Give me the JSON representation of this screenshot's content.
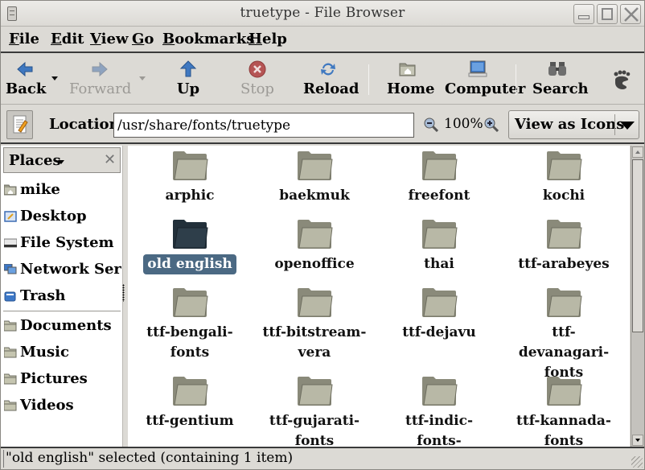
{
  "window": {
    "title": "truetype - File Browser",
    "controls": [
      "minimize",
      "maximize",
      "close"
    ]
  },
  "menubar": {
    "items": [
      {
        "label": "File",
        "mnemonic": "F"
      },
      {
        "label": "Edit",
        "mnemonic": "E"
      },
      {
        "label": "View",
        "mnemonic": "V"
      },
      {
        "label": "Go",
        "mnemonic": "G"
      },
      {
        "label": "Bookmarks",
        "mnemonic": "B"
      },
      {
        "label": "Help",
        "mnemonic": "H"
      }
    ]
  },
  "toolbar": {
    "back": {
      "label": "Back",
      "icon": "arrow-left-icon",
      "enabled": true
    },
    "forward": {
      "label": "Forward",
      "icon": "arrow-right-icon",
      "enabled": false
    },
    "up": {
      "label": "Up",
      "icon": "arrow-up-icon",
      "enabled": true
    },
    "stop": {
      "label": "Stop",
      "icon": "stop-icon",
      "enabled": false
    },
    "reload": {
      "label": "Reload",
      "icon": "reload-icon",
      "enabled": true
    },
    "home": {
      "label": "Home",
      "icon": "home-folder-icon",
      "enabled": true
    },
    "computer": {
      "label": "Computer",
      "icon": "computer-icon",
      "enabled": true
    },
    "search": {
      "label": "Search",
      "icon": "binoculars-icon",
      "enabled": true
    },
    "throbber": {
      "icon": "gnome-foot-icon"
    }
  },
  "locationbar": {
    "label": "Location:",
    "value": "/usr/share/fonts/truetype",
    "zoom_level": "100%",
    "view_mode": "View as Icons"
  },
  "sidebar": {
    "header": "Places",
    "places": [
      {
        "label": "mike",
        "icon": "home-folder-icon"
      },
      {
        "label": "Desktop",
        "icon": "desktop-icon"
      },
      {
        "label": "File System",
        "icon": "harddisk-icon"
      },
      {
        "label": "Network Servers",
        "icon": "network-icon"
      },
      {
        "label": "Trash",
        "icon": "trash-icon"
      }
    ],
    "bookmarks": [
      {
        "label": "Documents",
        "icon": "folder-icon"
      },
      {
        "label": "Music",
        "icon": "folder-icon"
      },
      {
        "label": "Pictures",
        "icon": "folder-icon"
      },
      {
        "label": "Videos",
        "icon": "folder-icon"
      }
    ]
  },
  "files": [
    {
      "name": "arphic",
      "selected": false
    },
    {
      "name": "baekmuk",
      "selected": false
    },
    {
      "name": "freefont",
      "selected": false
    },
    {
      "name": "kochi",
      "selected": false
    },
    {
      "name": "old english",
      "selected": true
    },
    {
      "name": "openoffice",
      "selected": false
    },
    {
      "name": "thai",
      "selected": false
    },
    {
      "name": "ttf-arabeyes",
      "selected": false
    },
    {
      "name": "ttf-bengali-fonts",
      "selected": false
    },
    {
      "name": "ttf-bitstream-vera",
      "selected": false
    },
    {
      "name": "ttf-dejavu",
      "selected": false
    },
    {
      "name": "ttf-devanagari-fonts",
      "selected": false
    },
    {
      "name": "ttf-gentium",
      "selected": false
    },
    {
      "name": "ttf-gujarati-fonts",
      "selected": false
    },
    {
      "name": "ttf-indic-fonts-core",
      "selected": false
    },
    {
      "name": "ttf-kannada-fonts",
      "selected": false
    }
  ],
  "colors": {
    "selection": "#4b6983",
    "folder": "#b8b8a6",
    "folder_selected": "#2e3e4a"
  },
  "statusbar": {
    "text": "\"old english\" selected (containing 1 item)"
  }
}
